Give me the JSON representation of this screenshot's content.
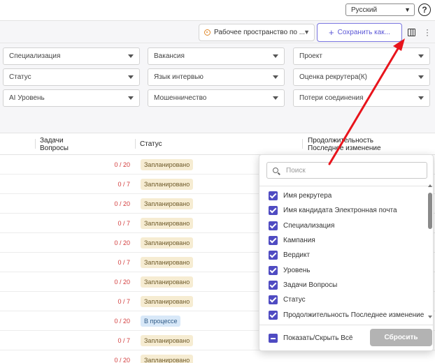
{
  "header": {
    "language": "Русский",
    "help_symbol": "?"
  },
  "toolbar": {
    "workspace_label": "Рабочее пространство по ...",
    "save_view_label": "Сохранить как..."
  },
  "filters": [
    "Специализация",
    "Вакансия",
    "Проект",
    "Статус",
    "Язык интервью",
    "Оценка рекрутера(К)",
    "AI Уровень",
    "Мошенничество",
    "Потери соединения"
  ],
  "table": {
    "headers": {
      "tasks_line1": "Задачи",
      "tasks_line2": "Вопросы",
      "status": "Статус",
      "duration_line1": "Продолжительность",
      "duration_line2": "Последнее изменение"
    },
    "rows": [
      {
        "tasks": "0 / 20",
        "status": "Запланировано"
      },
      {
        "tasks": "0 / 7",
        "status": "Запланировано"
      },
      {
        "tasks": "0 / 20",
        "status": "Запланировано"
      },
      {
        "tasks": "0 / 7",
        "status": "Запланировано"
      },
      {
        "tasks": "0 / 20",
        "status": "Запланировано"
      },
      {
        "tasks": "0 / 7",
        "status": "Запланировано"
      },
      {
        "tasks": "0 / 20",
        "status": "Запланировано"
      },
      {
        "tasks": "0 / 7",
        "status": "Запланировано"
      },
      {
        "tasks": "0 / 20",
        "status": "В процессе"
      },
      {
        "tasks": "0 / 7",
        "status": "Запланировано"
      },
      {
        "tasks": "0 / 20",
        "status": "Запланировано"
      }
    ]
  },
  "column_picker": {
    "search_placeholder": "Поиск",
    "columns": [
      "Имя рекрутера",
      "Имя кандидата Электронная почта",
      "Специализация",
      "Кампания",
      "Вердикт",
      "Уровень",
      "Задачи Вопросы",
      "Статус",
      "Продолжительность Последнее изменение"
    ],
    "toggle_all_label": "Показать/Скрыть Всё",
    "reset_label": "Сбросить"
  },
  "colors": {
    "accent": "#4f4bc2",
    "annotation_arrow": "#e8141c",
    "planned_badge": "#f6ecd2",
    "progress_badge": "#d8e8f8",
    "tasks_text": "#d23b3b"
  }
}
